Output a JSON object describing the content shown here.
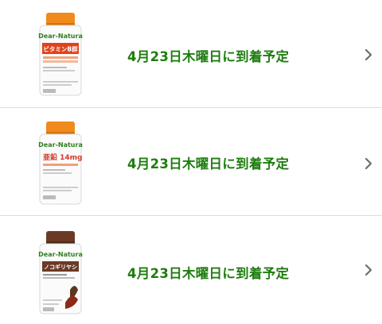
{
  "items": [
    {
      "brand": "Dear-Natura",
      "product": "ビタミンB群",
      "delivery": "4月23日木曜日に到着予定",
      "band_color": "#e0431c",
      "icon": "chevron-right-icon"
    },
    {
      "brand": "Dear-Natura",
      "product": "亜鉛 14mg",
      "delivery": "4月23日木曜日に到着予定",
      "band_color": "#d23a2a",
      "icon": "chevron-right-icon"
    },
    {
      "brand": "Dear-Natura",
      "product": "ノコギリヤシ",
      "delivery": "4月23日木曜日に到着予定",
      "band_color": "#6b3a25",
      "icon": "chevron-right-icon"
    }
  ],
  "colors": {
    "delivery_text": "#1e7d0e",
    "chevron": "#6e6e6e",
    "divider": "#dcdcdc",
    "cap": "#f08a1c"
  }
}
